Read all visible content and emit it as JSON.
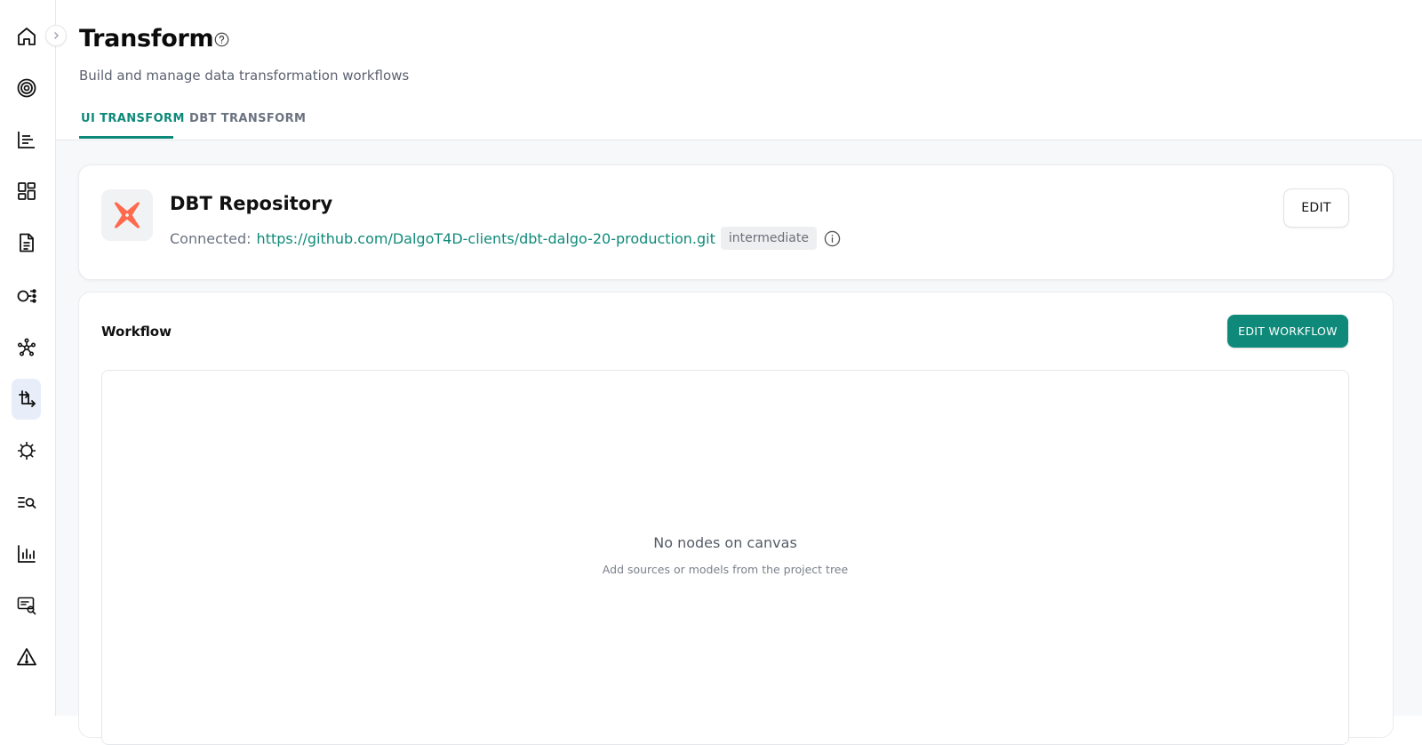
{
  "sidebar": {
    "items": [
      {
        "icon": "home-icon"
      },
      {
        "icon": "target-icon"
      },
      {
        "icon": "bar-list-icon"
      },
      {
        "icon": "dashboard-icon"
      },
      {
        "icon": "document-icon"
      },
      {
        "icon": "pipeline-icon"
      },
      {
        "icon": "network-icon"
      },
      {
        "icon": "transform-icon",
        "active": true
      },
      {
        "icon": "virus-icon"
      },
      {
        "icon": "search-list-icon"
      },
      {
        "icon": "bar-chart-icon"
      },
      {
        "icon": "monitor-search-icon"
      },
      {
        "icon": "warning-icon"
      }
    ],
    "collapse_icon": "chevron-right-icon"
  },
  "header": {
    "title": "Transform",
    "subtitle": "Build and manage data transformation workflows",
    "tabs": [
      {
        "label": "UI TRANSFORM",
        "active": true
      },
      {
        "label": "DBT TRANSFORM",
        "active": false
      }
    ]
  },
  "repo": {
    "title": "DBT Repository",
    "connected_label": "Connected:",
    "url": "https://github.com/DalgoT4D-clients/dbt-dalgo-20-production.git",
    "branch": "intermediate",
    "edit_label": "EDIT"
  },
  "workflow": {
    "title": "Workflow",
    "edit_label": "EDIT WORKFLOW",
    "empty_title": "No nodes on canvas",
    "empty_subtitle": "Add sources or models from the project tree"
  },
  "colors": {
    "accent": "#0f8a7a",
    "active_nav_bg": "#e7eef9",
    "dbt_logo": "#ff6a4d"
  }
}
